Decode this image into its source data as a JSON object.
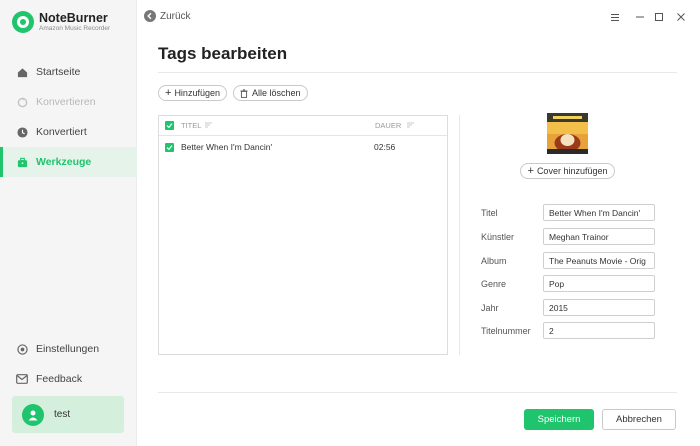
{
  "app": {
    "name": "NoteBurner",
    "subtitle": "Amazon Music Recorder"
  },
  "sidebar": {
    "items": [
      {
        "label": "Startseite",
        "icon": "home-icon",
        "state": "normal"
      },
      {
        "label": "Konvertieren",
        "icon": "convert-icon",
        "state": "disabled"
      },
      {
        "label": "Konvertiert",
        "icon": "clock-icon",
        "state": "normal"
      },
      {
        "label": "Werkzeuge",
        "icon": "toolbox-icon",
        "state": "active"
      }
    ],
    "bottom": [
      {
        "label": "Einstellungen",
        "icon": "gear-icon"
      },
      {
        "label": "Feedback",
        "icon": "mail-icon"
      }
    ],
    "user": {
      "name": "test"
    }
  },
  "topbar": {
    "back_label": "Zurück"
  },
  "page": {
    "title": "Tags bearbeiten"
  },
  "toolbar": {
    "add_label": "Hinzufügen",
    "clear_label": "Alle löschen"
  },
  "table": {
    "headers": {
      "title": "TITEL",
      "duration": "DAUER"
    },
    "rows": [
      {
        "title": "Better When I'm Dancin'",
        "duration": "02:56",
        "checked": true
      }
    ]
  },
  "cover": {
    "button_label": "Cover hinzufügen"
  },
  "fields": [
    {
      "label": "Titel",
      "value": "Better When I'm Dancin'"
    },
    {
      "label": "Künstler",
      "value": "Meghan Trainor"
    },
    {
      "label": "Album",
      "value": "The Peanuts Movie - Orig"
    },
    {
      "label": "Genre",
      "value": "Pop"
    },
    {
      "label": "Jahr",
      "value": "2015"
    },
    {
      "label": "Titelnummer",
      "value": "2"
    }
  ],
  "actions": {
    "save_label": "Speichern",
    "cancel_label": "Abbrechen"
  },
  "colors": {
    "accent": "#1fc46c",
    "active_bg": "#e6f3ea",
    "user_bg": "#d5efdd"
  }
}
